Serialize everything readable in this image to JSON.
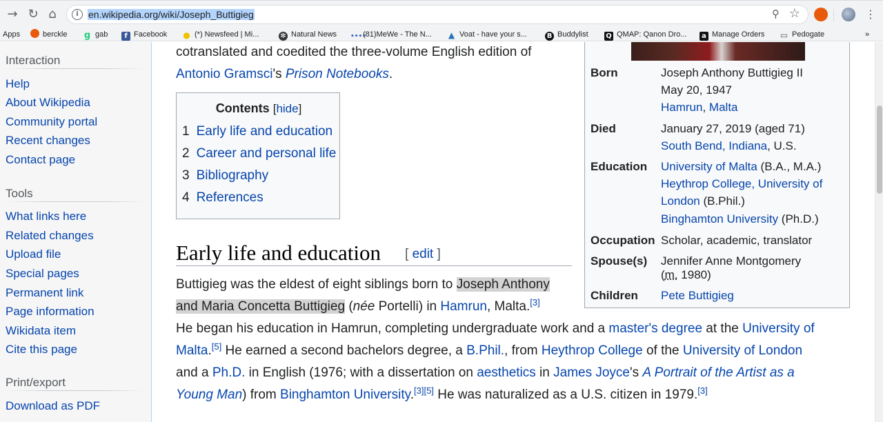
{
  "browser": {
    "url": "en.wikipedia.org/wiki/Joseph_Buttigieg",
    "bookmarks": [
      {
        "label": "Apps"
      },
      {
        "label": "berckle"
      },
      {
        "label": "gab"
      },
      {
        "label": "Facebook"
      },
      {
        "label": "(*) Newsfeed | Mi..."
      },
      {
        "label": "Natural News"
      },
      {
        "label": "(81)MeWe - The N..."
      },
      {
        "label": "Voat - have your s..."
      },
      {
        "label": "Buddylist"
      },
      {
        "label": "QMAP: Qanon Dro..."
      },
      {
        "label": "Manage Orders"
      },
      {
        "label": "Pedogate"
      }
    ],
    "more": "»"
  },
  "sidebar": {
    "interaction_heading": "Interaction",
    "interaction": [
      "Help",
      "About Wikipedia",
      "Community portal",
      "Recent changes",
      "Contact page"
    ],
    "tools_heading": "Tools",
    "tools": [
      "What links here",
      "Related changes",
      "Upload file",
      "Special pages",
      "Permanent link",
      "Page information",
      "Wikidata item",
      "Cite this page"
    ],
    "print_heading": "Print/export",
    "print": [
      "Download as PDF"
    ]
  },
  "content": {
    "intro_line1": "cotranslated and coedited the three-volume English edition of",
    "intro_link": "Antonio Gramsci",
    "intro_mid": "'s ",
    "intro_book": "Prison Notebooks",
    "intro_end": ".",
    "toc": {
      "title": "Contents",
      "hide": "hide",
      "items": [
        {
          "num": "1",
          "label": "Early life and education"
        },
        {
          "num": "2",
          "label": "Career and personal life"
        },
        {
          "num": "3",
          "label": "Bibliography"
        },
        {
          "num": "4",
          "label": "References"
        }
      ]
    },
    "heading": "Early life and education",
    "edit": "edit",
    "para": {
      "l1a": "Buttigieg was the eldest of eight siblings born to ",
      "l1hl": "Joseph Anthony",
      "l2hl": "and Maria Concetta Buttigieg",
      "l2b": " (",
      "l2nee": "née",
      "l2c": " Portelli) in ",
      "l2link": "Hamrun",
      "l2d": ", Malta.",
      "l2ref": "[3]",
      "l3a": "He began his education in Hamrun, completing undergraduate work and a ",
      "l3link1": "master's degree",
      "l3b": " at the ",
      "l3link2": "University of",
      "l4link": "Malta",
      "l4a": ".",
      "l4ref": "[5]",
      "l4b": " He earned a second bachelors degree, a ",
      "l4link2": "B.Phil.",
      "l4c": ", from ",
      "l4link3": "Heythrop College",
      "l4d": " of the ",
      "l4link4": "University of London",
      "l5a": "and a ",
      "l5link1": "Ph.D.",
      "l5b": " in English (1976; with a dissertation on ",
      "l5link2": "aesthetics",
      "l5c": " in ",
      "l5link3": "James Joyce",
      "l5d": "'s ",
      "l5link4": "A Portrait of the Artist as a",
      "l6link1": "Young Man",
      "l6a": ") from ",
      "l6link2": "Binghamton University",
      "l6b": ".",
      "l6ref1": "[3]",
      "l6ref2": "[5]",
      "l6c": " He was naturalized as a U.S. citizen in 1979.",
      "l6ref3": "[3]"
    }
  },
  "infobox": {
    "born_label": "Born",
    "born_name": "Joseph Anthony Buttigieg II",
    "born_date": "May 20, 1947",
    "born_place1": "Hamrun",
    "born_place_sep": ", ",
    "born_place2": "Malta",
    "died_label": "Died",
    "died_date": "January 27, 2019 (aged 71)",
    "died_place_link": "South Bend, Indiana",
    "died_place_rest": ", U.S.",
    "edu_label": "Education",
    "edu1_link": "University of Malta",
    "edu1_rest": " (B.A., M.A.)",
    "edu2_link_a": "Heythrop College, University of",
    "edu2_link_b": "London",
    "edu2_rest": " (B.Phil.)",
    "edu3_link": "Binghamton University",
    "edu3_rest": " (Ph.D.)",
    "occ_label": "Occupation",
    "occ_val": "Scholar, academic, translator",
    "spouse_label": "Spouse(s)",
    "spouse_val": "Jennifer Anne Montgomery",
    "spouse_m": "m.",
    "spouse_year": " 1980)",
    "children_label": "Children",
    "children_val": "Pete Buttigieg"
  }
}
